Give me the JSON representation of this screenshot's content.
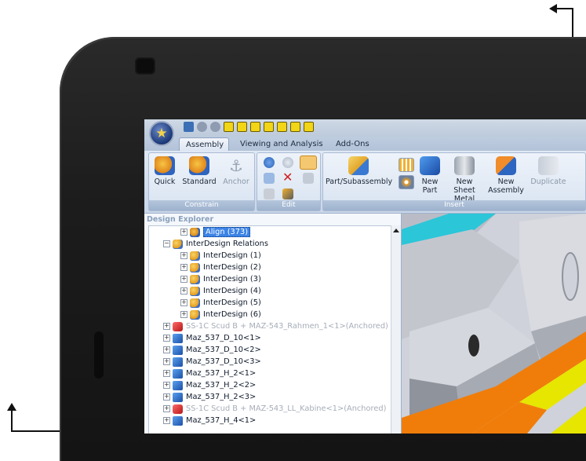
{
  "window": {
    "tabs": [
      {
        "label": "Assembly",
        "active": true
      },
      {
        "label": "Viewing and Analysis",
        "active": false
      },
      {
        "label": "Add-Ons",
        "active": false
      }
    ]
  },
  "ribbon": {
    "constrain": {
      "label": "Constrain",
      "buttons": [
        {
          "label": "Quick",
          "icon": "quick-constrain-icon"
        },
        {
          "label": "Standard",
          "icon": "standard-constrain-icon"
        },
        {
          "label": "Anchor",
          "icon": "anchor-icon",
          "disabled": true
        }
      ]
    },
    "edit": {
      "label": "Edit"
    },
    "insert": {
      "label": "Insert",
      "buttons": [
        {
          "label": "Part/Subassembly",
          "icon": "folder-part-icon"
        },
        {
          "label": "New Part",
          "icon": "new-part-icon"
        },
        {
          "label": "New Sheet Metal",
          "icon": "sheet-metal-icon"
        },
        {
          "label": "New Assembly",
          "icon": "new-assembly-icon"
        },
        {
          "label": "Duplicate",
          "icon": "duplicate-icon",
          "disabled": true
        }
      ]
    }
  },
  "explorer": {
    "title": "Design Explorer",
    "rows": [
      {
        "text": "Align (373)",
        "selected": true
      },
      {
        "text": "InterDesign Relations"
      },
      {
        "text": "InterDesign (1)"
      },
      {
        "text": "InterDesign (2)"
      },
      {
        "text": "InterDesign (3)"
      },
      {
        "text": "InterDesign (4)"
      },
      {
        "text": "InterDesign (5)"
      },
      {
        "text": "InterDesign (6)"
      },
      {
        "text": "SS-1C Scud B + MAZ-543_Rahmen_1<1>(Anchored)",
        "dim": true
      },
      {
        "text": "Maz_537_D_10<1>"
      },
      {
        "text": "Maz_537_D_10<2>"
      },
      {
        "text": "Maz_537_D_10<3>"
      },
      {
        "text": "Maz_537_H_2<1>"
      },
      {
        "text": "Maz_537_H_2<2>"
      },
      {
        "text": "Maz_537_H_2<3>"
      },
      {
        "text": "SS-1C Scud B + MAZ-543_LL_Kabine<1>(Anchored)",
        "dim": true
      },
      {
        "text": "Maz_537_H_4<1>"
      }
    ]
  },
  "colors": {
    "accent": "#3b83e6",
    "bezel": "#1c1c1c",
    "ribbon": "#dfe8f4",
    "model_orange": "#f07d0a",
    "model_yellow": "#e6e600",
    "model_cyan": "#2bc6d8"
  }
}
